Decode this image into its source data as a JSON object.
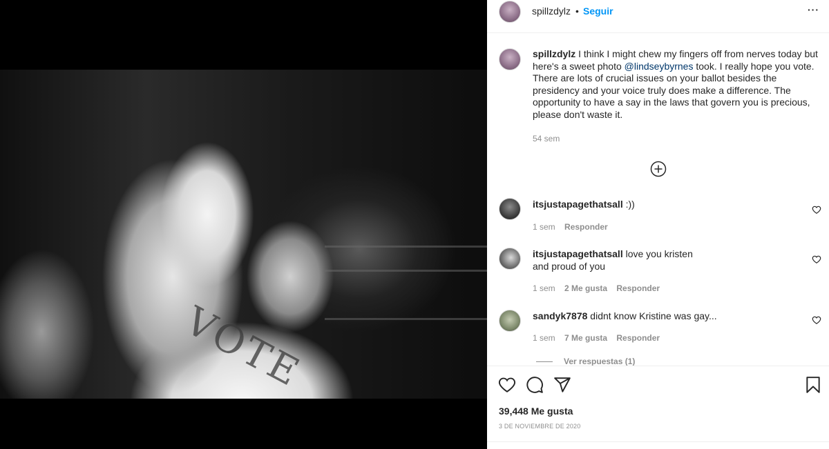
{
  "post": {
    "username": "spillzdylz",
    "separator": "•",
    "follow_label": "Seguir",
    "more_label": "···",
    "caption_parts": {
      "before": "I think I might chew my fingers off from nerves today but here's a sweet photo ",
      "mention": "@lindseybyrnes",
      "after": " took. I really hope you vote. There are lots of crucial issues on your ballot besides the presidency and your voice truly does make a difference. The opportunity to have a say in the laws that govern you is precious, please don't waste it."
    },
    "caption_time": "54 sem",
    "photo_text": "VOTE"
  },
  "comments": [
    {
      "username": "itsjustapagethatsall",
      "text": ":))",
      "time": "1 sem",
      "likes": "",
      "reply_label": "Responder"
    },
    {
      "username": "itsjustapagethatsall",
      "text": "love you kristen and proud of you",
      "time": "1 sem",
      "likes": "2 Me gusta",
      "reply_label": "Responder"
    },
    {
      "username": "sandyk7878",
      "text": "didnt know Kristine was gay...",
      "time": "1 sem",
      "likes": "7 Me gusta",
      "reply_label": "Responder"
    }
  ],
  "view_replies_label": "Ver respuestas (1)",
  "actions": {
    "likes_count": "39,448",
    "likes_suffix": "Me gusta",
    "date": "3 DE NOVIEMBRE DE 2020"
  },
  "icons": [
    "more-options-icon",
    "add-comments-icon",
    "heart-icon",
    "comment-icon",
    "share-icon",
    "save-icon"
  ],
  "colors": {
    "link": "#0095f6",
    "mention": "#00376b",
    "muted": "#8e8e8e",
    "text": "#262626"
  }
}
